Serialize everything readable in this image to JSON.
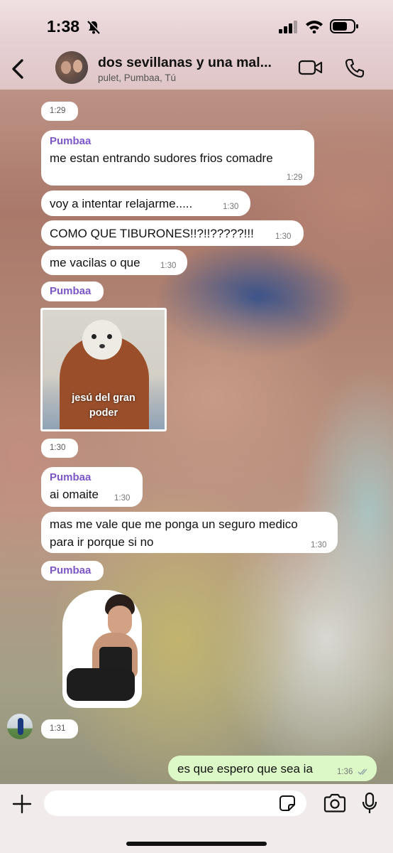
{
  "status_bar": {
    "time": "1:38"
  },
  "header": {
    "title": "dos sevillanas y una mal...",
    "subtitle": "pulet, Pumbaa, Tú"
  },
  "messages": {
    "sys_time_1": "1:29",
    "m1_sender": "Pumbaa",
    "m1_text": "me estan entrando sudores frios comadre",
    "m1_time": "1:29",
    "m2_text": "voy a intentar relajarme.....",
    "m2_time": "1:30",
    "m3_text": "COMO QUE TIBURONES!!?!!?????!!!",
    "m3_time": "1:30",
    "m4_text": "me vacilas o que",
    "m4_time": "1:30",
    "m5_sender": "Pumbaa",
    "m5_image_caption_1": "jesú del gran",
    "m5_image_caption_2": "poder",
    "m5_time": "1:30",
    "m6_sender": "Pumbaa",
    "m6_text": "ai omaite",
    "m6_time": "1:30",
    "m7_text_1": "mas me vale que me ponga un seguro medico",
    "m7_text_2": "para ir porque si no",
    "m7_time": "1:30",
    "m8_sender": "Pumbaa",
    "m8_time": "1:31",
    "out_text": "es que espero que sea ia",
    "out_time": "1:36"
  },
  "colors": {
    "sender_name": "#7d56c8",
    "outgoing_bubble": "#dcf8c6",
    "incoming_bubble": "#ffffff"
  },
  "icons": [
    "back-chevron-icon",
    "video-call-icon",
    "phone-icon",
    "plus-icon",
    "sticker-icon",
    "camera-icon",
    "mic-icon",
    "read-check-icon"
  ]
}
